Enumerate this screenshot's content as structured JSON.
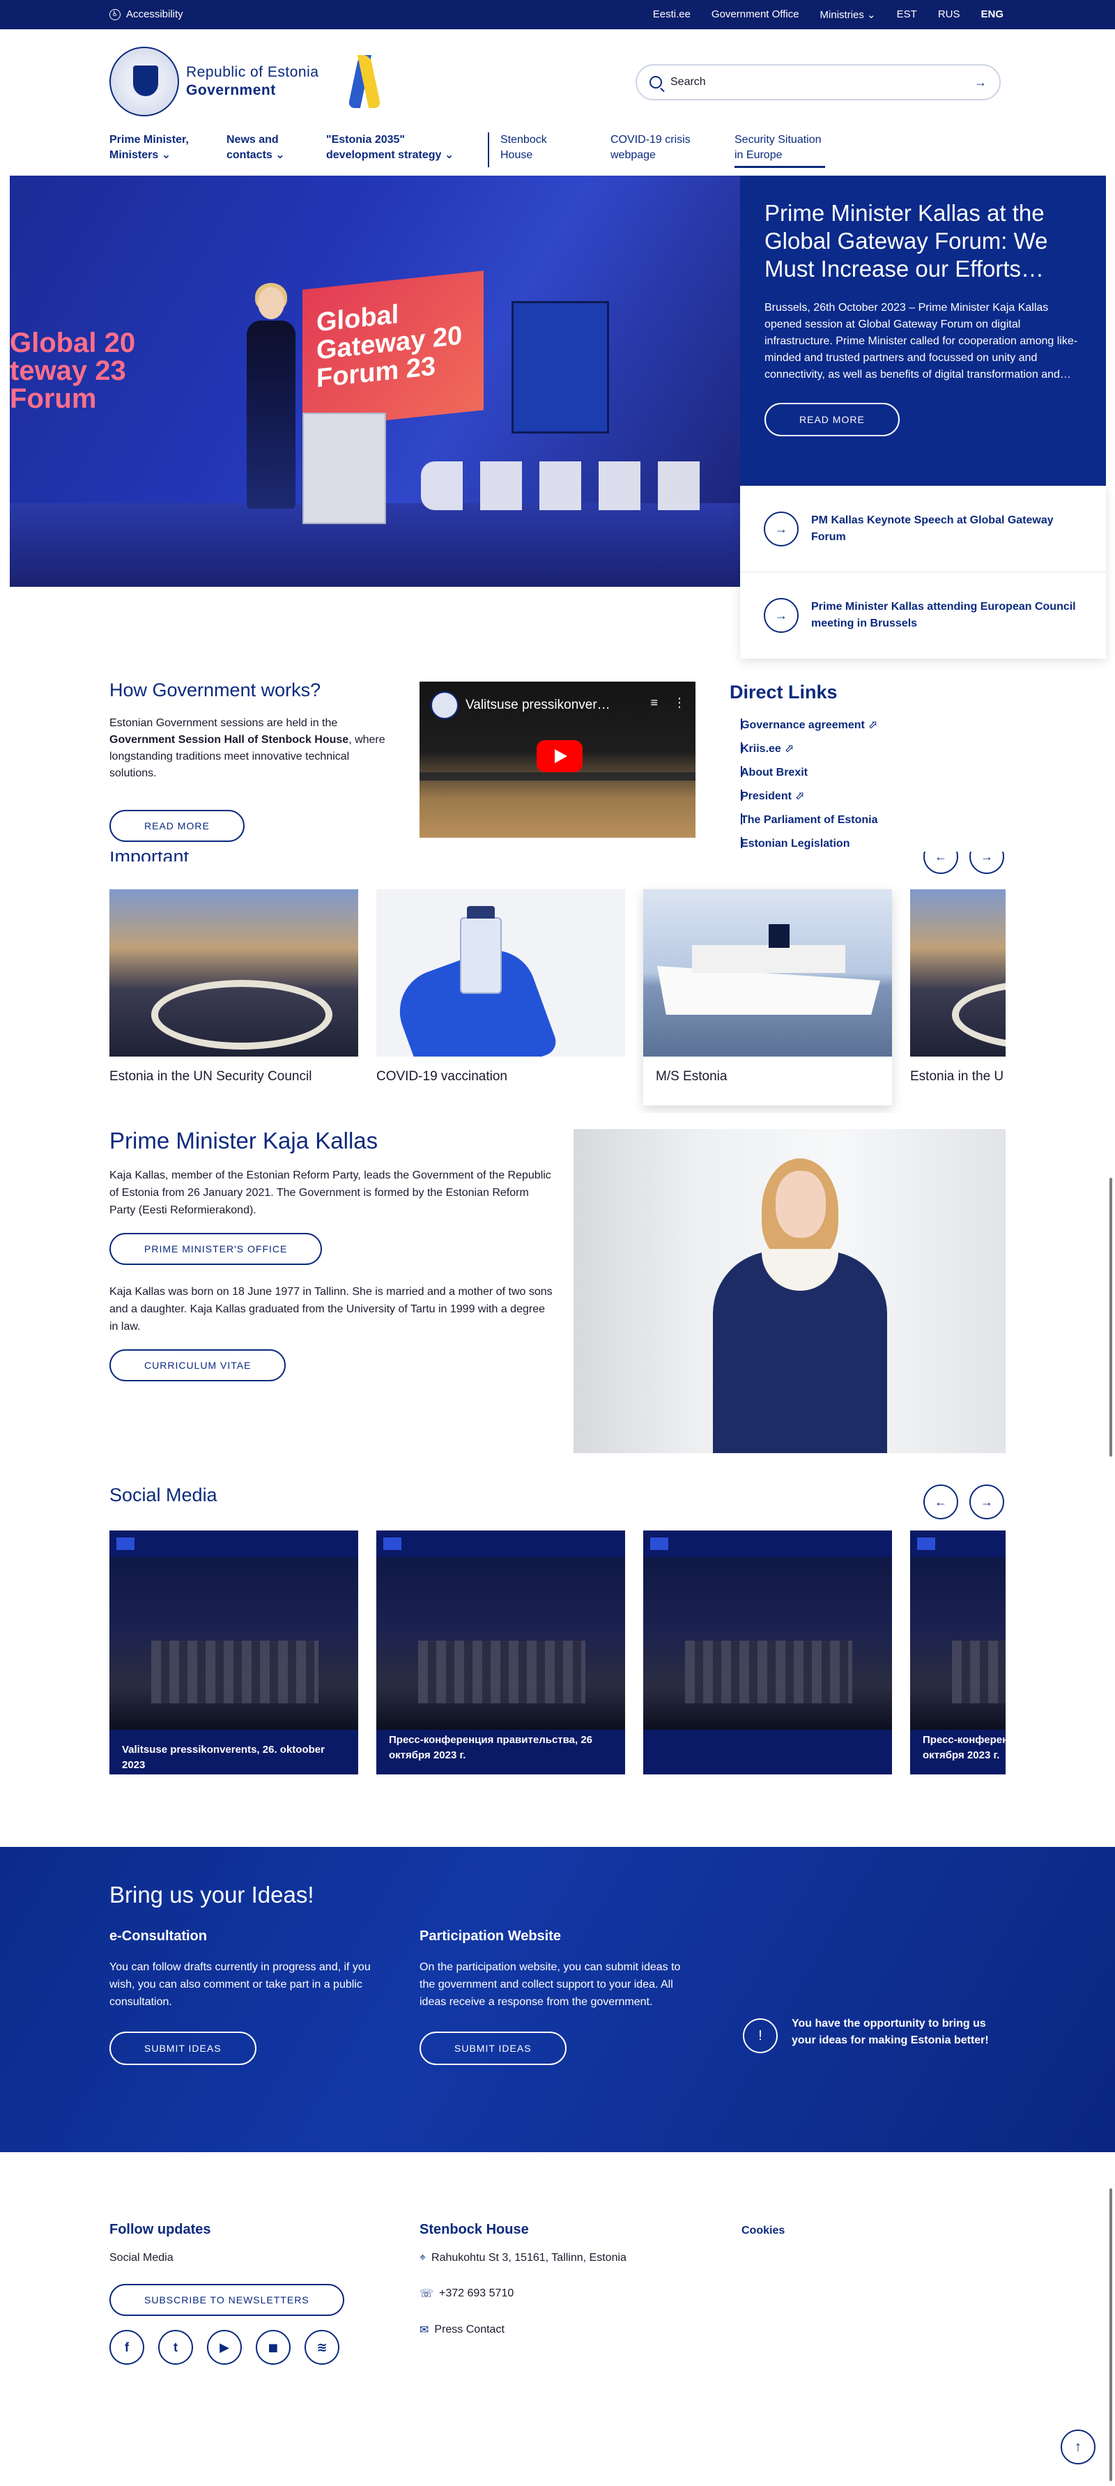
{
  "topbar": {
    "accessibility": "Accessibility",
    "links": [
      "Eesti.ee",
      "Government Office",
      "Ministries ⌄"
    ],
    "languages": [
      "EST",
      "RUS",
      "ENG"
    ],
    "active_language": "ENG"
  },
  "header": {
    "logo_line1": "Republic of Estonia",
    "logo_line2": "Government",
    "search_placeholder": "Search",
    "nav": [
      {
        "label": "Prime Minister, Ministers ⌄"
      },
      {
        "label": "News and contacts ⌄"
      },
      {
        "label": "\"Estonia 2035\" development strategy ⌄"
      },
      {
        "label": "Stenbock House"
      },
      {
        "label": "COVID-19 crisis webpage"
      },
      {
        "label": "Security Situation in Europe"
      }
    ]
  },
  "hero": {
    "image_text": "Global Gateway Forum 2023",
    "title": "Prime Minister Kallas at the Global Gateway Forum: We Must Increase our Efforts…",
    "summary": "Brussels, 26th October 2023 – Prime Minister Kaja Kallas opened session at Global Gateway Forum on digital infrastructure. Prime Minister called for cooperation among like-minded and trusted partners and focussed on unity and connectivity, as well as benefits of digital transformation and…",
    "read_more": "READ MORE",
    "related": [
      "PM Kallas Keynote Speech at Global Gateway Forum",
      "Prime Minister Kallas attending European Council meeting in Brussels"
    ]
  },
  "how_gov": {
    "title": "How Government works?",
    "text_before": "Estonian Government sessions are held in the ",
    "text_bold": "Government Session Hall of Stenbock House",
    "text_after": ", where longstanding traditions meet innovative technical solutions.",
    "button": "READ MORE",
    "video_title": "Valitsuse pressikonver…"
  },
  "direct_links": {
    "title": "Direct Links",
    "items": [
      "Governance agreement ⬀",
      "Kriis.ee ⬀",
      "About Brexit",
      "President ⬀",
      "The Parliament of Estonia",
      "Estonian Legislation"
    ]
  },
  "important": {
    "title": "Important",
    "cards": [
      "Estonia in the UN Security Council",
      "COVID-19 vaccination",
      "M/S Estonia",
      "Estonia in the U"
    ]
  },
  "pm": {
    "title": "Prime Minister Kaja Kallas",
    "p1": "Kaja Kallas, member of the Estonian Reform Party, leads the Government of the Republic of Estonia from 26 January 2021. The Government is formed by the Estonian Reform Party (Eesti Reformierakond).",
    "button1": "PRIME MINISTER'S OFFICE",
    "p2": "Kaja Kallas was born on 18 June 1977 in Tallinn. She is married and a mother of two sons and a daughter. Kaja Kallas graduated from the University of Tartu in 1999 with a degree in law.",
    "button2": "CURRICULUM VITAE"
  },
  "social": {
    "title": "Social Media",
    "cards": [
      "Valitsuse pressikonverents, 26. oktoober 2023",
      "Пресс-конференция правительства, 26 октября 2023 г.",
      "",
      "Пресс-конферен октября 2023 г."
    ]
  },
  "ideas": {
    "title": "Bring us your Ideas!",
    "col1_title": "e-Consultation",
    "col1_text": "You can follow drafts currently in progress and, if you wish, you can also comment or take part in a public consultation.",
    "col1_button": "SUBMIT IDEAS",
    "col2_title": "Participation Website",
    "col2_text": "On the participation website, you can submit ideas to the government and collect support to your idea. All ideas receive a response from the government.",
    "col2_button": "SUBMIT IDEAS",
    "note": "You have the opportunity to bring us your ideas for making Estonia better!"
  },
  "footer": {
    "follow_title": "Follow updates",
    "social_media": "Social Media",
    "newsletter_button": "SUBSCRIBE TO NEWSLETTERS",
    "socials": [
      "f",
      "t",
      "▶",
      "◼",
      "≋"
    ],
    "stenbock_title": "Stenbock House",
    "address": "Rahukohtu St 3, 15161, Tallinn, Estonia",
    "phone": "+372 693 5710",
    "press": "Press Contact",
    "cookies": "Cookies"
  }
}
